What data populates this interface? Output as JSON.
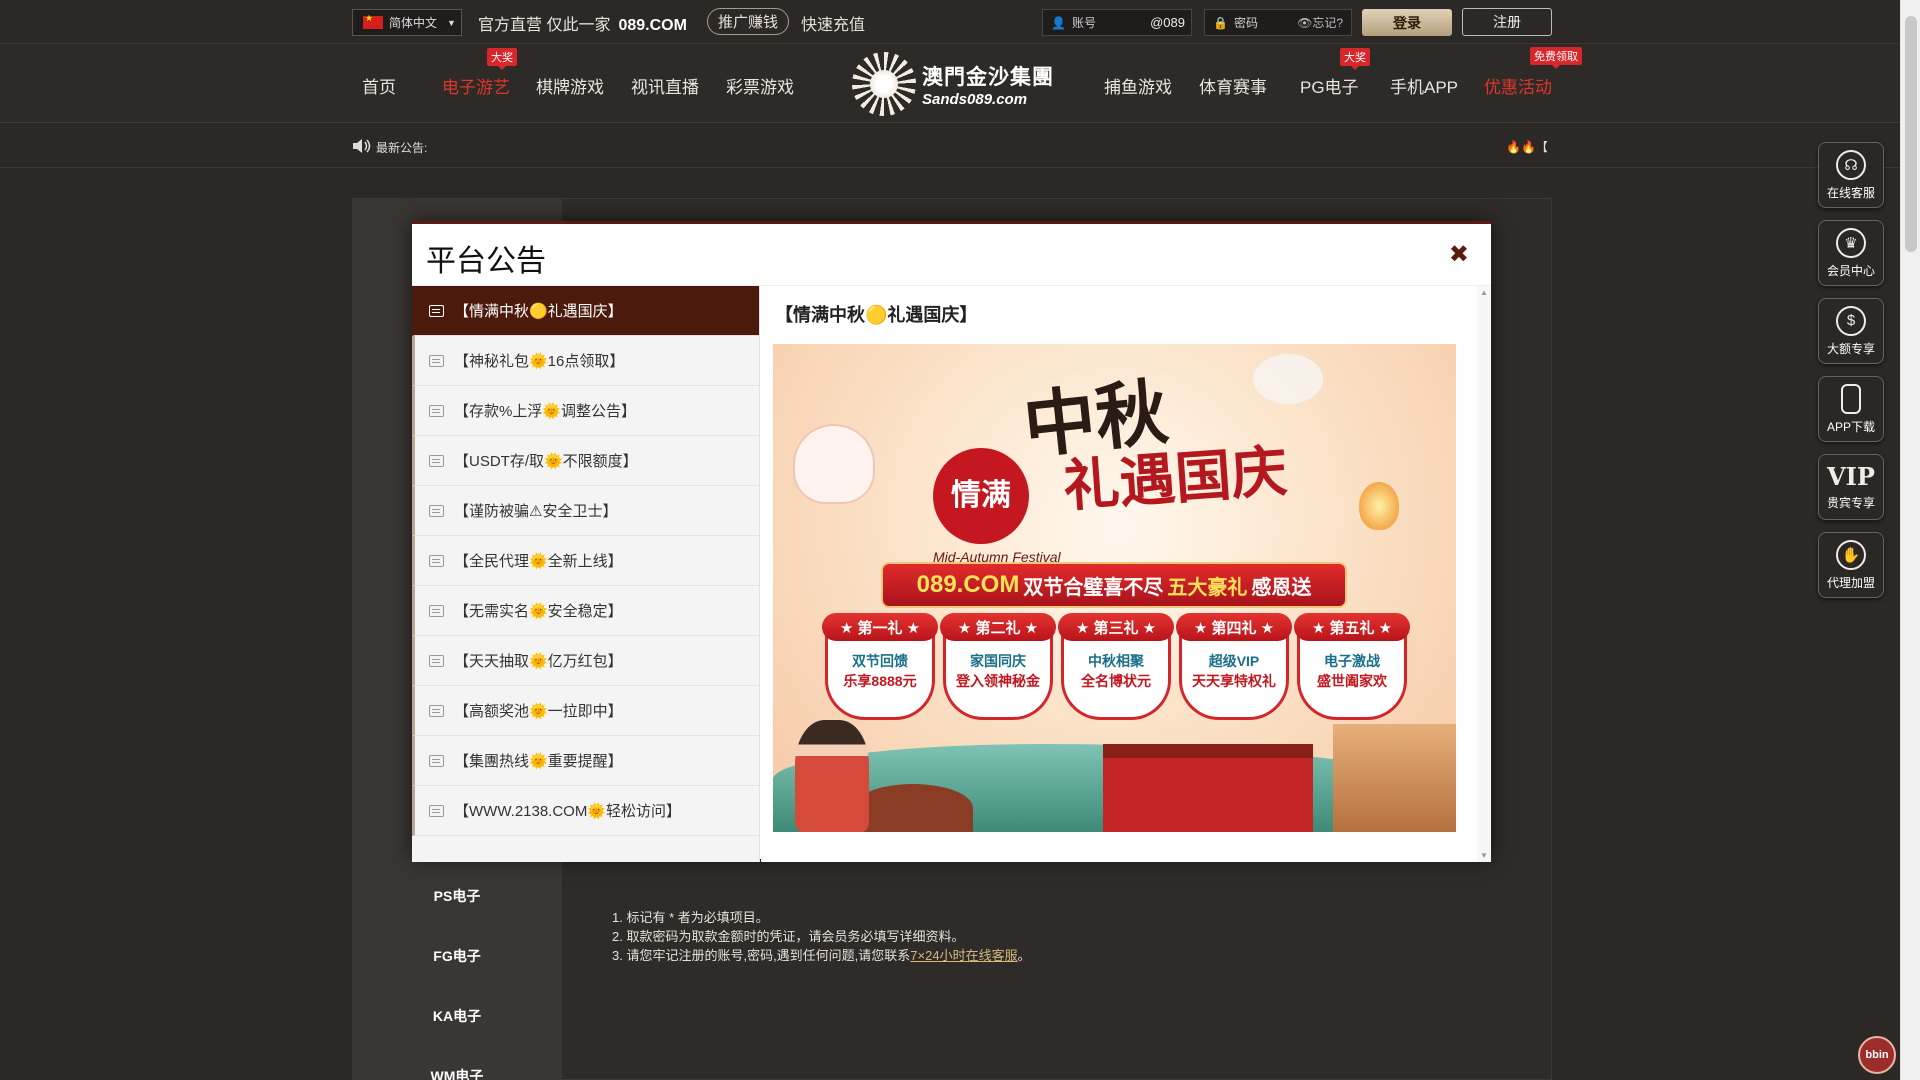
{
  "header": {
    "language": "简体中文",
    "slogan": "官方直营 仅此一家",
    "site": "089.COM",
    "promo_button": "推广赚钱",
    "quick_recharge": "快速充值",
    "account_label": "账号",
    "account_suffix": "@089",
    "password_label": "密码",
    "forgot": "忘记?",
    "login": "登录",
    "register": "注册"
  },
  "nav": {
    "items": [
      {
        "label": "首页"
      },
      {
        "label": "电子游艺",
        "badge": "大奖"
      },
      {
        "label": "棋牌游戏"
      },
      {
        "label": "视讯直播"
      },
      {
        "label": "彩票游戏"
      },
      {
        "label": "捕鱼游戏"
      },
      {
        "label": "体育赛事"
      },
      {
        "label": "PG电子",
        "badge": "大奖"
      },
      {
        "label": "手机APP"
      },
      {
        "label": "优惠活动",
        "badge": "免费领取"
      }
    ],
    "logo_cn": "澳門金沙集團",
    "logo_en": "Sands089.com"
  },
  "announcement": {
    "label": "最新公告:",
    "marquee": "🔥🔥【"
  },
  "sidebar": {
    "items": [
      "PS电子",
      "FG电子",
      "KA电子",
      "WM电子"
    ]
  },
  "notes": {
    "line1": "1. 标记有 * 者为必填项目。",
    "line2": "2. 取款密码为取款金额时的凭证，请会员务必填写详细资料。",
    "line3_prefix": "3. 请您牢记注册的账号,密码,遇到任何问题,请您联系",
    "line3_link": "7×24小时在线客服",
    "line3_suffix": "。"
  },
  "float_menu": [
    {
      "label": "在线客服",
      "icon": "headset-icon"
    },
    {
      "label": "会员中心",
      "icon": "crown-icon"
    },
    {
      "label": "大额专享",
      "icon": "money-bag-icon"
    },
    {
      "label": "APP下载",
      "icon": "phone-icon"
    },
    {
      "label": "贵宾专享",
      "icon": "vip-icon"
    },
    {
      "label": "代理加盟",
      "icon": "handshake-icon"
    }
  ],
  "bbin": "bbin",
  "modal": {
    "title": "平台公告",
    "close": "✖",
    "active_title": "【情满中秋🟡礼遇国庆】",
    "items": [
      "【情满中秋🟡礼遇国庆】",
      "【神秘礼包🌞16点领取】",
      "【存款%上浮🌞调整公告】",
      "【USDT存/取🌞不限额度】",
      "【谨防被骗⚠安全卫士】",
      "【全民代理🌞全新上线】",
      "【无需实名🌞安全稳定】",
      "【天天抽取🌞亿万红包】",
      "【高额奖池🌞一拉即中】",
      "【集團热线🌞重要提醒】",
      "【WWW.2138.COM🌞轻松访问】"
    ]
  },
  "banner": {
    "title1": "中秋",
    "seal": "情满",
    "title2": "礼遇国庆",
    "fest_en": "Mid-Autumn Festival",
    "ribbon_site": "089.COM",
    "ribbon_mid": "双节合璧喜不尽",
    "ribbon_five": "五大豪礼",
    "ribbon_end": "感恩送",
    "gifts": [
      {
        "head": "★ 第一礼 ★",
        "line1": "双节回馈",
        "line2": "乐享8888元"
      },
      {
        "head": "★ 第二礼 ★",
        "line1": "家国同庆",
        "line2": "登入领神秘金"
      },
      {
        "head": "★ 第三礼 ★",
        "line1": "中秋相聚",
        "line2": "全名博状元"
      },
      {
        "head": "★ 第四礼 ★",
        "line1": "超级VIP",
        "line2": "天天享特权礼"
      },
      {
        "head": "★ 第五礼 ★",
        "line1": "电子激战",
        "line2": "盛世阖家欢"
      }
    ]
  }
}
